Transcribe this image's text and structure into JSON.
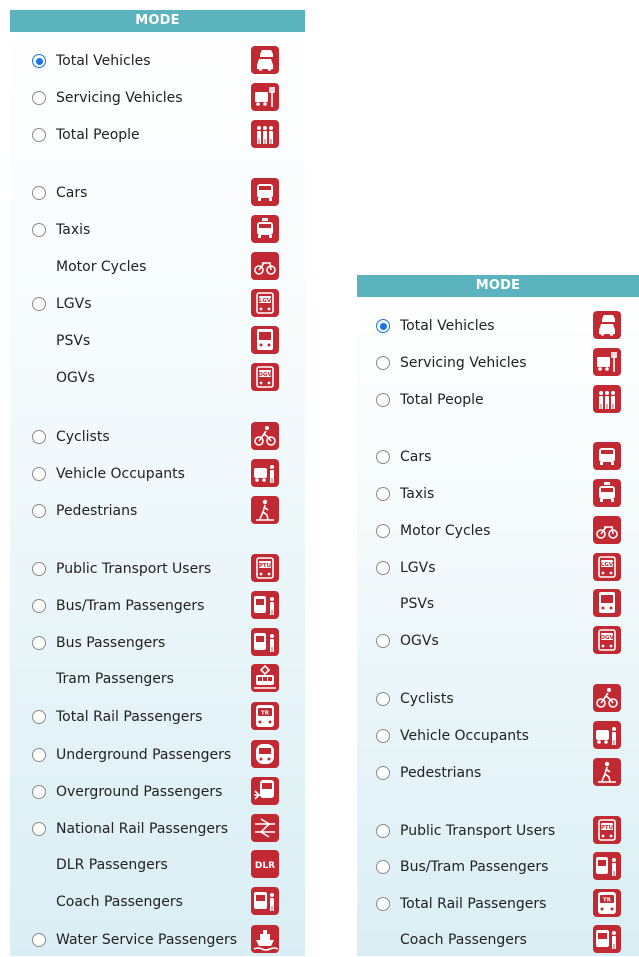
{
  "panels": [
    {
      "header": "MODE",
      "items": [
        {
          "label": "Total Vehicles",
          "radio": true,
          "checked": true,
          "icon": "total-vehicles-icon"
        },
        {
          "label": "Servicing Vehicles",
          "radio": true,
          "checked": false,
          "icon": "servicing-vehicles-icon"
        },
        {
          "label": "Total People",
          "radio": true,
          "checked": false,
          "icon": "total-people-icon"
        },
        {
          "label": "Cars",
          "radio": true,
          "checked": false,
          "icon": "car-icon"
        },
        {
          "label": "Taxis",
          "radio": true,
          "checked": false,
          "icon": "taxi-icon"
        },
        {
          "label": "Motor Cycles",
          "radio": false,
          "checked": false,
          "icon": "motorcycle-icon"
        },
        {
          "label": "LGVs",
          "radio": true,
          "checked": false,
          "icon": "lgv-icon",
          "icon_text": "LGV"
        },
        {
          "label": "PSVs",
          "radio": false,
          "checked": false,
          "icon": "psv-icon"
        },
        {
          "label": "OGVs",
          "radio": false,
          "checked": false,
          "icon": "ogv-icon",
          "icon_text": "OGV"
        },
        {
          "label": "Cyclists",
          "radio": true,
          "checked": false,
          "icon": "cyclist-icon"
        },
        {
          "label": "Vehicle Occupants",
          "radio": true,
          "checked": false,
          "icon": "vehicle-occupants-icon"
        },
        {
          "label": "Pedestrians",
          "radio": true,
          "checked": false,
          "icon": "pedestrian-icon"
        },
        {
          "label": "Public Transport Users",
          "radio": true,
          "checked": false,
          "icon": "public-transport-icon",
          "icon_text": "PTU"
        },
        {
          "label": "Bus/Tram Passengers",
          "radio": true,
          "checked": false,
          "icon": "bus-tram-passengers-icon"
        },
        {
          "label": "Bus Passengers",
          "radio": true,
          "checked": false,
          "icon": "bus-passengers-icon"
        },
        {
          "label": "Tram Passengers",
          "radio": false,
          "checked": false,
          "icon": "tram-icon"
        },
        {
          "label": "Total Rail Passengers",
          "radio": true,
          "checked": false,
          "icon": "total-rail-icon",
          "icon_text": "TR"
        },
        {
          "label": "Underground Passengers",
          "radio": true,
          "checked": false,
          "icon": "underground-icon"
        },
        {
          "label": "Overground Passengers",
          "radio": true,
          "checked": false,
          "icon": "overground-icon"
        },
        {
          "label": "National Rail Passengers",
          "radio": true,
          "checked": false,
          "icon": "national-rail-icon"
        },
        {
          "label": "DLR Passengers",
          "radio": false,
          "checked": false,
          "icon": "dlr-icon",
          "icon_text": "DLR"
        },
        {
          "label": "Coach Passengers",
          "radio": false,
          "checked": false,
          "icon": "coach-icon"
        },
        {
          "label": "Water Service Passengers",
          "radio": true,
          "checked": false,
          "icon": "water-service-icon"
        }
      ]
    },
    {
      "header": "MODE",
      "items": [
        {
          "label": "Total Vehicles",
          "radio": true,
          "checked": true,
          "icon": "total-vehicles-icon"
        },
        {
          "label": "Servicing Vehicles",
          "radio": true,
          "checked": false,
          "icon": "servicing-vehicles-icon"
        },
        {
          "label": "Total People",
          "radio": true,
          "checked": false,
          "icon": "total-people-icon"
        },
        {
          "label": "Cars",
          "radio": true,
          "checked": false,
          "icon": "car-icon"
        },
        {
          "label": "Taxis",
          "radio": true,
          "checked": false,
          "icon": "taxi-icon"
        },
        {
          "label": "Motor Cycles",
          "radio": true,
          "checked": false,
          "icon": "motorcycle-icon"
        },
        {
          "label": "LGVs",
          "radio": true,
          "checked": false,
          "icon": "lgv-icon",
          "icon_text": "LGV"
        },
        {
          "label": "PSVs",
          "radio": false,
          "checked": false,
          "icon": "psv-icon"
        },
        {
          "label": "OGVs",
          "radio": true,
          "checked": false,
          "icon": "ogv-icon",
          "icon_text": "OGV"
        },
        {
          "label": "Cyclists",
          "radio": true,
          "checked": false,
          "icon": "cyclist-icon"
        },
        {
          "label": "Vehicle Occupants",
          "radio": true,
          "checked": false,
          "icon": "vehicle-occupants-icon"
        },
        {
          "label": "Pedestrians",
          "radio": true,
          "checked": false,
          "icon": "pedestrian-icon"
        },
        {
          "label": "Public Transport Users",
          "radio": true,
          "checked": false,
          "icon": "public-transport-icon",
          "icon_text": "PTU"
        },
        {
          "label": "Bus/Tram Passengers",
          "radio": true,
          "checked": false,
          "icon": "bus-tram-passengers-icon"
        },
        {
          "label": "Total Rail Passengers",
          "radio": true,
          "checked": false,
          "icon": "total-rail-icon",
          "icon_text": "TR"
        },
        {
          "label": "Coach Passengers",
          "radio": false,
          "checked": false,
          "icon": "coach-icon"
        }
      ]
    }
  ],
  "colors": {
    "header_bg": "#5ab3bd",
    "icon_bg": "#c22a33",
    "radio_checked": "#1a73e8"
  }
}
